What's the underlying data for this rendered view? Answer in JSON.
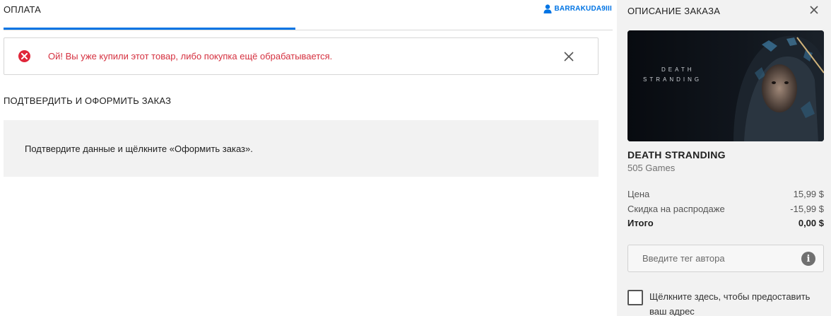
{
  "header": {
    "tab_title": "ОПЛАТА",
    "username": "BARRAKUDA9III"
  },
  "alert": {
    "message": "Ой! Вы уже купили этот товар, либо покупка ещё обрабатывается."
  },
  "confirm": {
    "section_title": "ПОДТВЕРДИТЬ И ОФОРМИТЬ ЗАКАЗ",
    "instruction": "Подтвердите данные и щёлкните «Оформить заказ»."
  },
  "order": {
    "title": "ОПИСАНИЕ ЗАКАЗА",
    "hero_logo_line1": "DEATH",
    "hero_logo_line2": "STRANDING",
    "game_title": "DEATH STRANDING",
    "publisher": "505 Games",
    "price_label": "Цена",
    "price_value": "15,99 $",
    "discount_label": "Скидка на распродаже",
    "discount_value": "-15,99 $",
    "total_label": "Итого",
    "total_value": "0,00 $",
    "creator_placeholder": "Введите тег автора",
    "address_label": "Щёлкните здесь, чтобы предоставить ваш адрес"
  },
  "colors": {
    "accent": "#0074e4",
    "error": "#e0273a",
    "panel_bg": "#f2f2f2"
  },
  "icons": [
    "user-icon",
    "error-icon",
    "close-icon",
    "info-icon"
  ]
}
